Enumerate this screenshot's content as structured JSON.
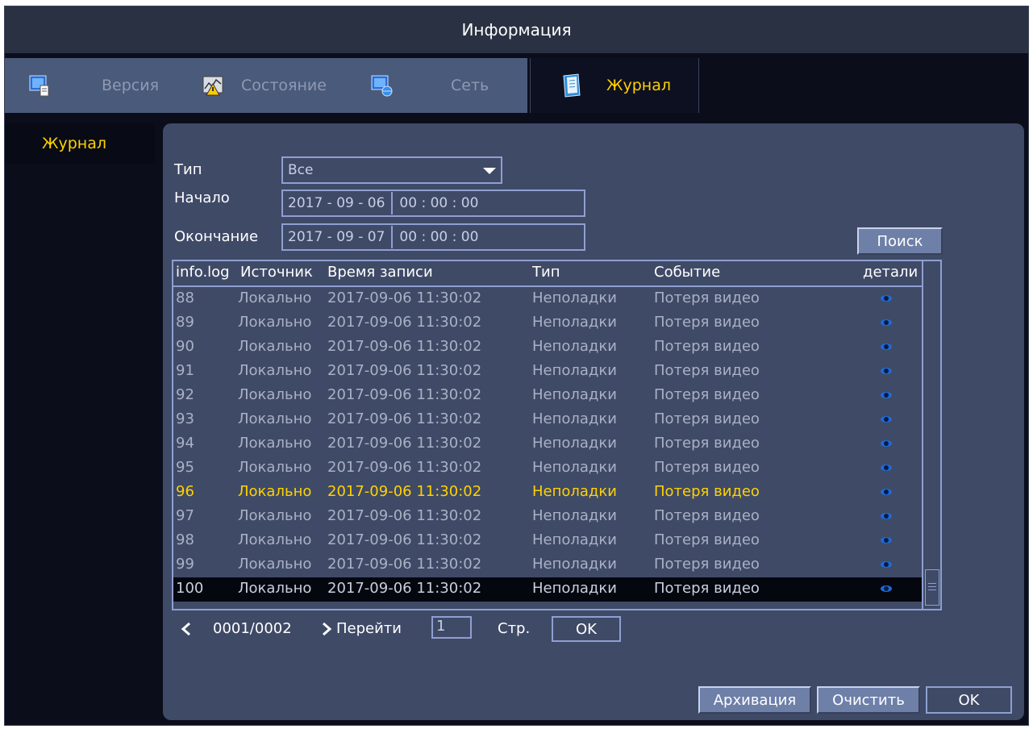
{
  "window": {
    "title": "Информация"
  },
  "tabs": [
    {
      "label": "Версия",
      "icon": "monitor-doc-icon",
      "active": false
    },
    {
      "label": "Состояние",
      "icon": "warning-graph-icon",
      "active": false
    },
    {
      "label": "Сеть",
      "icon": "network-monitor-icon",
      "active": false
    },
    {
      "label": "Журнал",
      "icon": "log-book-icon",
      "active": true
    }
  ],
  "sidebar": {
    "items": [
      {
        "label": "Журнал",
        "active": true
      }
    ]
  },
  "filters": {
    "type_label": "Тип",
    "type_value": "Все",
    "start_label": "Начало",
    "start_date": "2017  - 09 - 06",
    "start_time": "00 :  00 :  00",
    "end_label": "Окончание",
    "end_date": "2017  - 09 - 07",
    "end_time": "00 :  00 :  00",
    "search_button": "Поиск"
  },
  "log_table": {
    "columns": [
      "info.log",
      "Источник",
      "Время записи",
      "Тип",
      "Событие",
      "детали"
    ],
    "rows": [
      {
        "id": "88",
        "source": "Локально",
        "time": "2017-09-06 11:30:02",
        "type": "Неполадки",
        "event": "Потеря видео"
      },
      {
        "id": "89",
        "source": "Локально",
        "time": "2017-09-06 11:30:02",
        "type": "Неполадки",
        "event": "Потеря видео"
      },
      {
        "id": "90",
        "source": "Локально",
        "time": "2017-09-06 11:30:02",
        "type": "Неполадки",
        "event": "Потеря видео"
      },
      {
        "id": "91",
        "source": "Локально",
        "time": "2017-09-06 11:30:02",
        "type": "Неполадки",
        "event": "Потеря видео"
      },
      {
        "id": "92",
        "source": "Локально",
        "time": "2017-09-06 11:30:02",
        "type": "Неполадки",
        "event": "Потеря видео"
      },
      {
        "id": "93",
        "source": "Локально",
        "time": "2017-09-06 11:30:02",
        "type": "Неполадки",
        "event": "Потеря видео"
      },
      {
        "id": "94",
        "source": "Локально",
        "time": "2017-09-06 11:30:02",
        "type": "Неполадки",
        "event": "Потеря видео"
      },
      {
        "id": "95",
        "source": "Локально",
        "time": "2017-09-06 11:30:02",
        "type": "Неполадки",
        "event": "Потеря видео"
      },
      {
        "id": "96",
        "source": "Локально",
        "time": "2017-09-06 11:30:02",
        "type": "Неполадки",
        "event": "Потеря видео"
      },
      {
        "id": "97",
        "source": "Локально",
        "time": "2017-09-06 11:30:02",
        "type": "Неполадки",
        "event": "Потеря видео"
      },
      {
        "id": "98",
        "source": "Локально",
        "time": "2017-09-06 11:30:02",
        "type": "Неполадки",
        "event": "Потеря видео"
      },
      {
        "id": "99",
        "source": "Локально",
        "time": "2017-09-06 11:30:02",
        "type": "Неполадки",
        "event": "Потеря видео"
      },
      {
        "id": "100",
        "source": "Локально",
        "time": "2017-09-06 11:30:02",
        "type": "Неполадки",
        "event": "Потеря видео"
      }
    ],
    "highlighted_row": "96",
    "selected_row": "100"
  },
  "pager": {
    "prev_icon": "chevron-left-icon",
    "next_icon": "chevron-right-icon",
    "page_info": "0001/0002",
    "goto_label": "Перейти",
    "goto_value": "1",
    "page_suffix": "Стр.",
    "ok_label": "OK"
  },
  "footer": {
    "backup_button": "Архивация",
    "clear_button": "Очистить",
    "ok_button": "OK"
  },
  "colors": {
    "accent": "#ffd200",
    "panel": "#3f4a67",
    "border": "#8f9fd0",
    "background": "#0b0e1a"
  }
}
